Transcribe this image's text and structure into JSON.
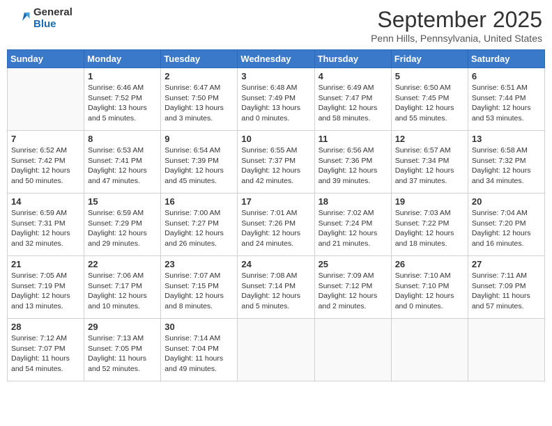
{
  "logo": {
    "general": "General",
    "blue": "Blue"
  },
  "title": "September 2025",
  "subtitle": "Penn Hills, Pennsylvania, United States",
  "days_of_week": [
    "Sunday",
    "Monday",
    "Tuesday",
    "Wednesday",
    "Thursday",
    "Friday",
    "Saturday"
  ],
  "weeks": [
    [
      {
        "day": "",
        "info": ""
      },
      {
        "day": "1",
        "info": "Sunrise: 6:46 AM\nSunset: 7:52 PM\nDaylight: 13 hours\nand 5 minutes."
      },
      {
        "day": "2",
        "info": "Sunrise: 6:47 AM\nSunset: 7:50 PM\nDaylight: 13 hours\nand 3 minutes."
      },
      {
        "day": "3",
        "info": "Sunrise: 6:48 AM\nSunset: 7:49 PM\nDaylight: 13 hours\nand 0 minutes."
      },
      {
        "day": "4",
        "info": "Sunrise: 6:49 AM\nSunset: 7:47 PM\nDaylight: 12 hours\nand 58 minutes."
      },
      {
        "day": "5",
        "info": "Sunrise: 6:50 AM\nSunset: 7:45 PM\nDaylight: 12 hours\nand 55 minutes."
      },
      {
        "day": "6",
        "info": "Sunrise: 6:51 AM\nSunset: 7:44 PM\nDaylight: 12 hours\nand 53 minutes."
      }
    ],
    [
      {
        "day": "7",
        "info": "Sunrise: 6:52 AM\nSunset: 7:42 PM\nDaylight: 12 hours\nand 50 minutes."
      },
      {
        "day": "8",
        "info": "Sunrise: 6:53 AM\nSunset: 7:41 PM\nDaylight: 12 hours\nand 47 minutes."
      },
      {
        "day": "9",
        "info": "Sunrise: 6:54 AM\nSunset: 7:39 PM\nDaylight: 12 hours\nand 45 minutes."
      },
      {
        "day": "10",
        "info": "Sunrise: 6:55 AM\nSunset: 7:37 PM\nDaylight: 12 hours\nand 42 minutes."
      },
      {
        "day": "11",
        "info": "Sunrise: 6:56 AM\nSunset: 7:36 PM\nDaylight: 12 hours\nand 39 minutes."
      },
      {
        "day": "12",
        "info": "Sunrise: 6:57 AM\nSunset: 7:34 PM\nDaylight: 12 hours\nand 37 minutes."
      },
      {
        "day": "13",
        "info": "Sunrise: 6:58 AM\nSunset: 7:32 PM\nDaylight: 12 hours\nand 34 minutes."
      }
    ],
    [
      {
        "day": "14",
        "info": "Sunrise: 6:59 AM\nSunset: 7:31 PM\nDaylight: 12 hours\nand 32 minutes."
      },
      {
        "day": "15",
        "info": "Sunrise: 6:59 AM\nSunset: 7:29 PM\nDaylight: 12 hours\nand 29 minutes."
      },
      {
        "day": "16",
        "info": "Sunrise: 7:00 AM\nSunset: 7:27 PM\nDaylight: 12 hours\nand 26 minutes."
      },
      {
        "day": "17",
        "info": "Sunrise: 7:01 AM\nSunset: 7:26 PM\nDaylight: 12 hours\nand 24 minutes."
      },
      {
        "day": "18",
        "info": "Sunrise: 7:02 AM\nSunset: 7:24 PM\nDaylight: 12 hours\nand 21 minutes."
      },
      {
        "day": "19",
        "info": "Sunrise: 7:03 AM\nSunset: 7:22 PM\nDaylight: 12 hours\nand 18 minutes."
      },
      {
        "day": "20",
        "info": "Sunrise: 7:04 AM\nSunset: 7:20 PM\nDaylight: 12 hours\nand 16 minutes."
      }
    ],
    [
      {
        "day": "21",
        "info": "Sunrise: 7:05 AM\nSunset: 7:19 PM\nDaylight: 12 hours\nand 13 minutes."
      },
      {
        "day": "22",
        "info": "Sunrise: 7:06 AM\nSunset: 7:17 PM\nDaylight: 12 hours\nand 10 minutes."
      },
      {
        "day": "23",
        "info": "Sunrise: 7:07 AM\nSunset: 7:15 PM\nDaylight: 12 hours\nand 8 minutes."
      },
      {
        "day": "24",
        "info": "Sunrise: 7:08 AM\nSunset: 7:14 PM\nDaylight: 12 hours\nand 5 minutes."
      },
      {
        "day": "25",
        "info": "Sunrise: 7:09 AM\nSunset: 7:12 PM\nDaylight: 12 hours\nand 2 minutes."
      },
      {
        "day": "26",
        "info": "Sunrise: 7:10 AM\nSunset: 7:10 PM\nDaylight: 12 hours\nand 0 minutes."
      },
      {
        "day": "27",
        "info": "Sunrise: 7:11 AM\nSunset: 7:09 PM\nDaylight: 11 hours\nand 57 minutes."
      }
    ],
    [
      {
        "day": "28",
        "info": "Sunrise: 7:12 AM\nSunset: 7:07 PM\nDaylight: 11 hours\nand 54 minutes."
      },
      {
        "day": "29",
        "info": "Sunrise: 7:13 AM\nSunset: 7:05 PM\nDaylight: 11 hours\nand 52 minutes."
      },
      {
        "day": "30",
        "info": "Sunrise: 7:14 AM\nSunset: 7:04 PM\nDaylight: 11 hours\nand 49 minutes."
      },
      {
        "day": "",
        "info": ""
      },
      {
        "day": "",
        "info": ""
      },
      {
        "day": "",
        "info": ""
      },
      {
        "day": "",
        "info": ""
      }
    ]
  ]
}
